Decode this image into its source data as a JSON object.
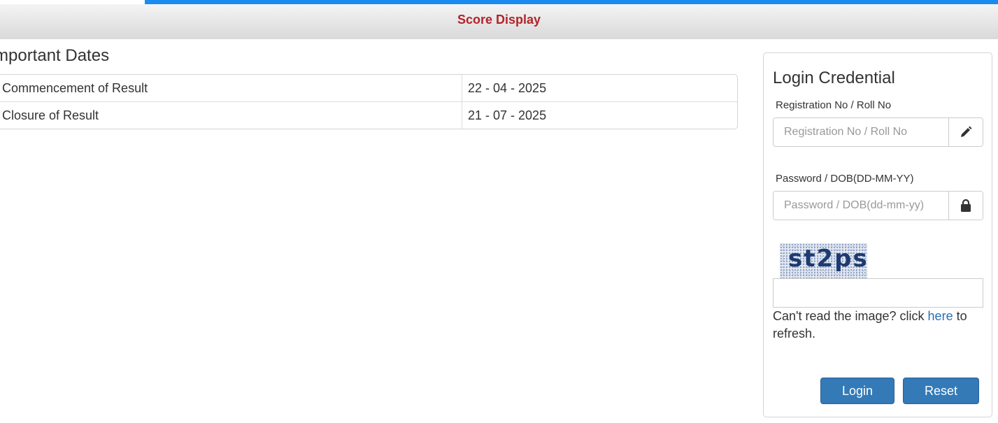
{
  "colors": {
    "top_accent": "#1a8cf0",
    "header_title": "#b3242a",
    "primary_button": "#337ab7"
  },
  "header": {
    "title": "Score Display"
  },
  "important_dates": {
    "heading": "mportant Dates",
    "rows": [
      {
        "label": "Commencement of Result",
        "value": "22 - 04 - 2025"
      },
      {
        "label": "Closure of Result",
        "value": "21 - 07 - 2025"
      }
    ]
  },
  "login": {
    "title": "Login Credential",
    "registration": {
      "label": "Registration No / Roll No",
      "placeholder": "Registration No / Roll No",
      "value": "",
      "icon": "pencil-icon"
    },
    "password": {
      "label": "Password / DOB(DD-MM-YY)",
      "placeholder": "Password / DOB(dd-mm-yy)",
      "value": "",
      "icon": "lock-icon"
    },
    "captcha": {
      "image_text": "st2ps",
      "input_value": "",
      "help_prefix": "Can't read the image? click ",
      "help_link": "here",
      "help_suffix": " to refresh."
    },
    "buttons": {
      "login": "Login",
      "reset": "Reset"
    }
  }
}
